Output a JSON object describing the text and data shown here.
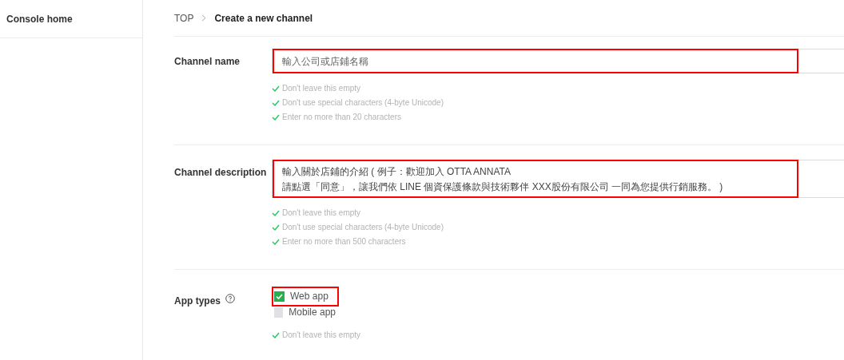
{
  "sidebar": {
    "items": [
      {
        "label": "Console home",
        "selected": false
      }
    ]
  },
  "breadcrumb": [
    {
      "label": "TOP",
      "current": false
    },
    {
      "label": "Create a new channel",
      "current": true
    }
  ],
  "fields": [
    {
      "kind": "text",
      "label": "Channel name",
      "value": "輸入公司或店鋪名稱",
      "highlighted": true,
      "rules": [
        {
          "text": "Don't leave this empty",
          "passed": true
        },
        {
          "text": "Don't use special characters (4-byte Unicode)",
          "passed": true
        },
        {
          "text": "Enter no more than 20 characters",
          "passed": true
        }
      ]
    },
    {
      "kind": "textarea",
      "label": "Channel description",
      "value": "輸入關於店鋪的介紹 ( 例子：歡迎加入 OTTA ANNATA\n請點選「同意」，讓我們依 LINE 個資保護條款與技術夥伴 XXX股份有限公司 一同為您提供行銷服務。 )",
      "highlighted": true,
      "rules": [
        {
          "text": "Don't leave this empty",
          "passed": true
        },
        {
          "text": "Don't use special characters (4-byte Unicode)",
          "passed": true
        },
        {
          "text": "Enter no more than 500 characters",
          "passed": true
        }
      ]
    },
    {
      "kind": "checkboxes",
      "label": "App types",
      "help": true,
      "options": [
        {
          "label": "Web app",
          "checked": true,
          "highlighted": true
        },
        {
          "label": "Mobile app",
          "checked": false,
          "highlighted": false
        }
      ],
      "rules": [
        {
          "text": "Don't leave this empty",
          "passed": true
        }
      ]
    }
  ]
}
